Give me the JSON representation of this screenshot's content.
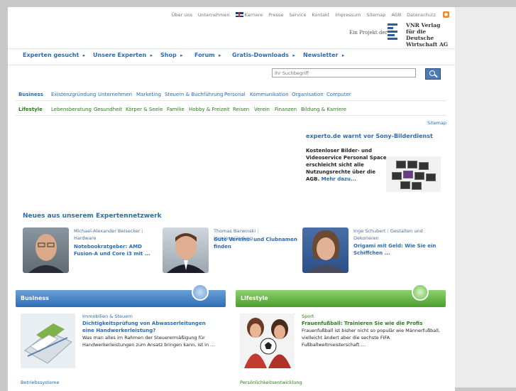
{
  "topnav": {
    "items": [
      "Über uns",
      "Unternehmen",
      "Karriere",
      "Presse",
      "Service",
      "Kontakt",
      "Impressum",
      "Sitemap",
      "AGB",
      "Datenschutz"
    ],
    "rss_label": "RSS"
  },
  "publisher": {
    "prefix": "Ein Projekt der",
    "line1": "VNR Verlag",
    "line2": "für die Deutsche",
    "line3": "Wirtschaft AG"
  },
  "mainnav": [
    "Experten gesucht",
    "Unsere Experten",
    "Shop",
    "Forum",
    "Gratis-Downloads",
    "Newsletter"
  ],
  "search": {
    "placeholder": "Ihr Suchbegriff"
  },
  "business_bar": {
    "head": "Business",
    "items": [
      "Existenzgründung",
      "Unternehmen",
      "Marketing",
      "Steuern & Buchführung",
      "Personal",
      "Kommunikation",
      "Organisation",
      "Computer"
    ]
  },
  "lifestyle_bar": {
    "head": "Lifestyle",
    "items": [
      "Lebensberatung",
      "Gesundheit",
      "Körper & Seele",
      "Familie",
      "Hobby & Freizeit",
      "Reisen",
      "Verein",
      "Finanzen",
      "Bildung & Karriere"
    ]
  },
  "sitemap": "Sitemap",
  "warning": {
    "title": "experto.de warnt vor Sony-Bilderdienst",
    "text": "Kostenloser Bilder- und Videoservice Personal Space erschleicht sicht alle Nutzungsrechte über die AGB.",
    "more": "Mehr dazu..."
  },
  "network": {
    "title": "Neues aus unserem Expertennetzwerk",
    "experts": [
      {
        "name": "Michael-Alexander Beisecker",
        "topic": "Hardware",
        "title": "Notebookratgeber: AMD Fusion-A und Core i3 mit ..."
      },
      {
        "name": "Thomas Barwinski",
        "topic": "Vereinsgründung",
        "title": "Gute Vereins- und Clubnamen finden"
      },
      {
        "name": "Inge Schubert",
        "topic": "Gestalten und Dekorieren",
        "title": "Origami mit Geld: Wie Sie ein Schiffchen ..."
      }
    ]
  },
  "boxes": {
    "business": {
      "label": "Business",
      "category": "Immobilien & Steuern",
      "title": "Dichtigkeitsprüfung von Abwasserleitungen eine Handwerkerleistung?",
      "text": "Was man alles im Rahmen der Steuerermäßigung für Handwerkerleistungen zum Ansatz bringen kann, ist in ...",
      "next_category": "Betriebssysteme"
    },
    "lifestyle": {
      "label": "Lifestyle",
      "category": "Sport",
      "title": "Frauenfußball: Trainieren Sie wie die Profis",
      "text": "Frauenfußball ist bisher nicht so populär wie Männerfußball, vielleicht ändert aber die sechste FIFA Fußballweltmeisterschaft ...",
      "next_category": "Persönlichkeitsentwicklung"
    }
  },
  "colors": {
    "business_blue": "#2a6bb5",
    "lifestyle_green": "#2e7a1f",
    "box_blue": "#2f6db3",
    "box_green": "#4c9e2c"
  }
}
